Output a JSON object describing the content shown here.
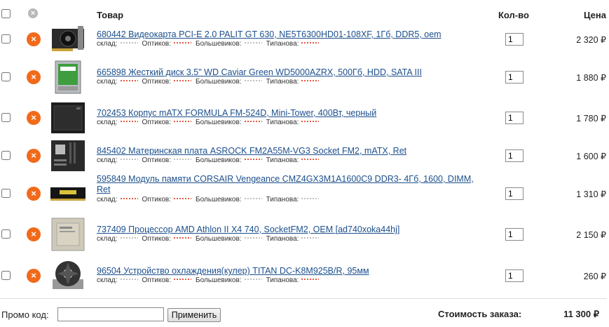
{
  "header": {
    "product_label": "Товар",
    "qty_label": "Кол-во",
    "price_label": "Цена"
  },
  "stock_labels": {
    "warehouse": "склад:",
    "store1": "Оптиков:",
    "store2": "Большевиков:",
    "store3": "Типанова:"
  },
  "items": [
    {
      "title": "680442 Видеокарта PCI-E 2.0 PALIT GT 630, NE5T6300HD01-108XF, 1Гб, DDR5, oem",
      "qty": "1",
      "price": "2 320 ₽",
      "thumb": "gpu-image",
      "stock": [
        "grey",
        "red",
        "grey",
        "red"
      ]
    },
    {
      "title": "665898 Жесткий диск 3.5\" WD Caviar Green WD5000AZRX, 500Гб, HDD, SATA III",
      "qty": "1",
      "price": "1 880 ₽",
      "thumb": "hdd-image",
      "stock": [
        "red",
        "red",
        "grey",
        "red"
      ]
    },
    {
      "title": "702453 Корпус mATX FORMULA FM-524D, Mini-Tower, 400Вт, черный",
      "qty": "1",
      "price": "1 780 ₽",
      "thumb": "case-image",
      "stock": [
        "red",
        "red",
        "red",
        "red"
      ]
    },
    {
      "title": "845402 Материнская плата ASROCK FM2A55M-VG3 Socket FM2, mATX, Ret",
      "qty": "1",
      "price": "1 600 ₽",
      "thumb": "motherboard-image",
      "stock": [
        "grey",
        "grey",
        "red",
        "red"
      ]
    },
    {
      "title": "595849 Модуль памяти CORSAIR Vengeance CMZ4GX3M1A1600C9 DDR3- 4Гб, 1600, DIMM, Ret",
      "qty": "1",
      "price": "1 310 ₽",
      "thumb": "ram-image",
      "stock": [
        "red",
        "red",
        "grey",
        "grey"
      ]
    },
    {
      "title": "737409 Процессор AMD Athlon II X4 740, SocketFM2, OEM [ad740xoka44hj]",
      "qty": "1",
      "price": "2 150 ₽",
      "thumb": "cpu-image",
      "stock": [
        "grey",
        "red",
        "grey",
        "grey"
      ]
    },
    {
      "title": "96504 Устройство охлаждения(кулер) TITAN DC-K8M925B/R, 95мм",
      "qty": "1",
      "price": "260 ₽",
      "thumb": "cooler-image",
      "stock": [
        "grey",
        "red",
        "grey",
        "red"
      ]
    }
  ],
  "footer": {
    "promo_label": "Промо код:",
    "promo_value": "",
    "apply_label": "Применить",
    "total_label": "Стоимость заказа:",
    "total_value": "11 300 ₽"
  },
  "colors": {
    "remove": "#f06a1a",
    "link": "#1c4f8c",
    "in_stock_dots": "#e0442a",
    "no_stock_dots": "#b5b5b5"
  }
}
